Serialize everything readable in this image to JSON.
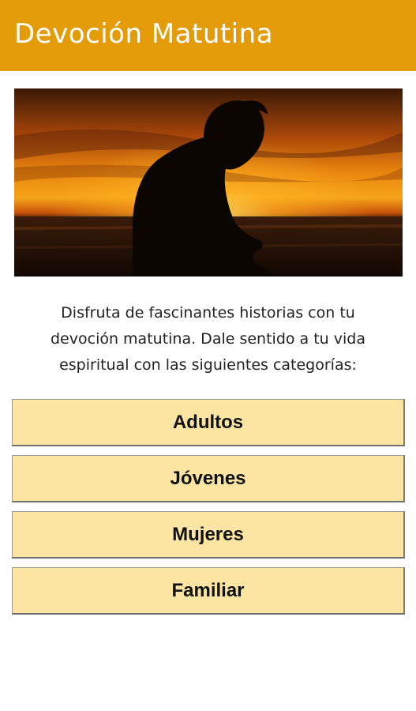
{
  "app_bar": {
    "title": "Devoción Matutina",
    "color": "#e39b08"
  },
  "hero": {
    "icon": "praying-silhouette-sunset-image"
  },
  "intro": {
    "lines": [
      "Disfruta de fascinantes historias con tu",
      "devoción matutina. Dale sentido a tu vida",
      "espiritual con las siguientes categorías:"
    ]
  },
  "categories": {
    "button_color": "#fce4a3",
    "items": [
      {
        "label": "Adultos"
      },
      {
        "label": "Jóvenes"
      },
      {
        "label": "Mujeres"
      },
      {
        "label": "Familiar"
      }
    ]
  }
}
